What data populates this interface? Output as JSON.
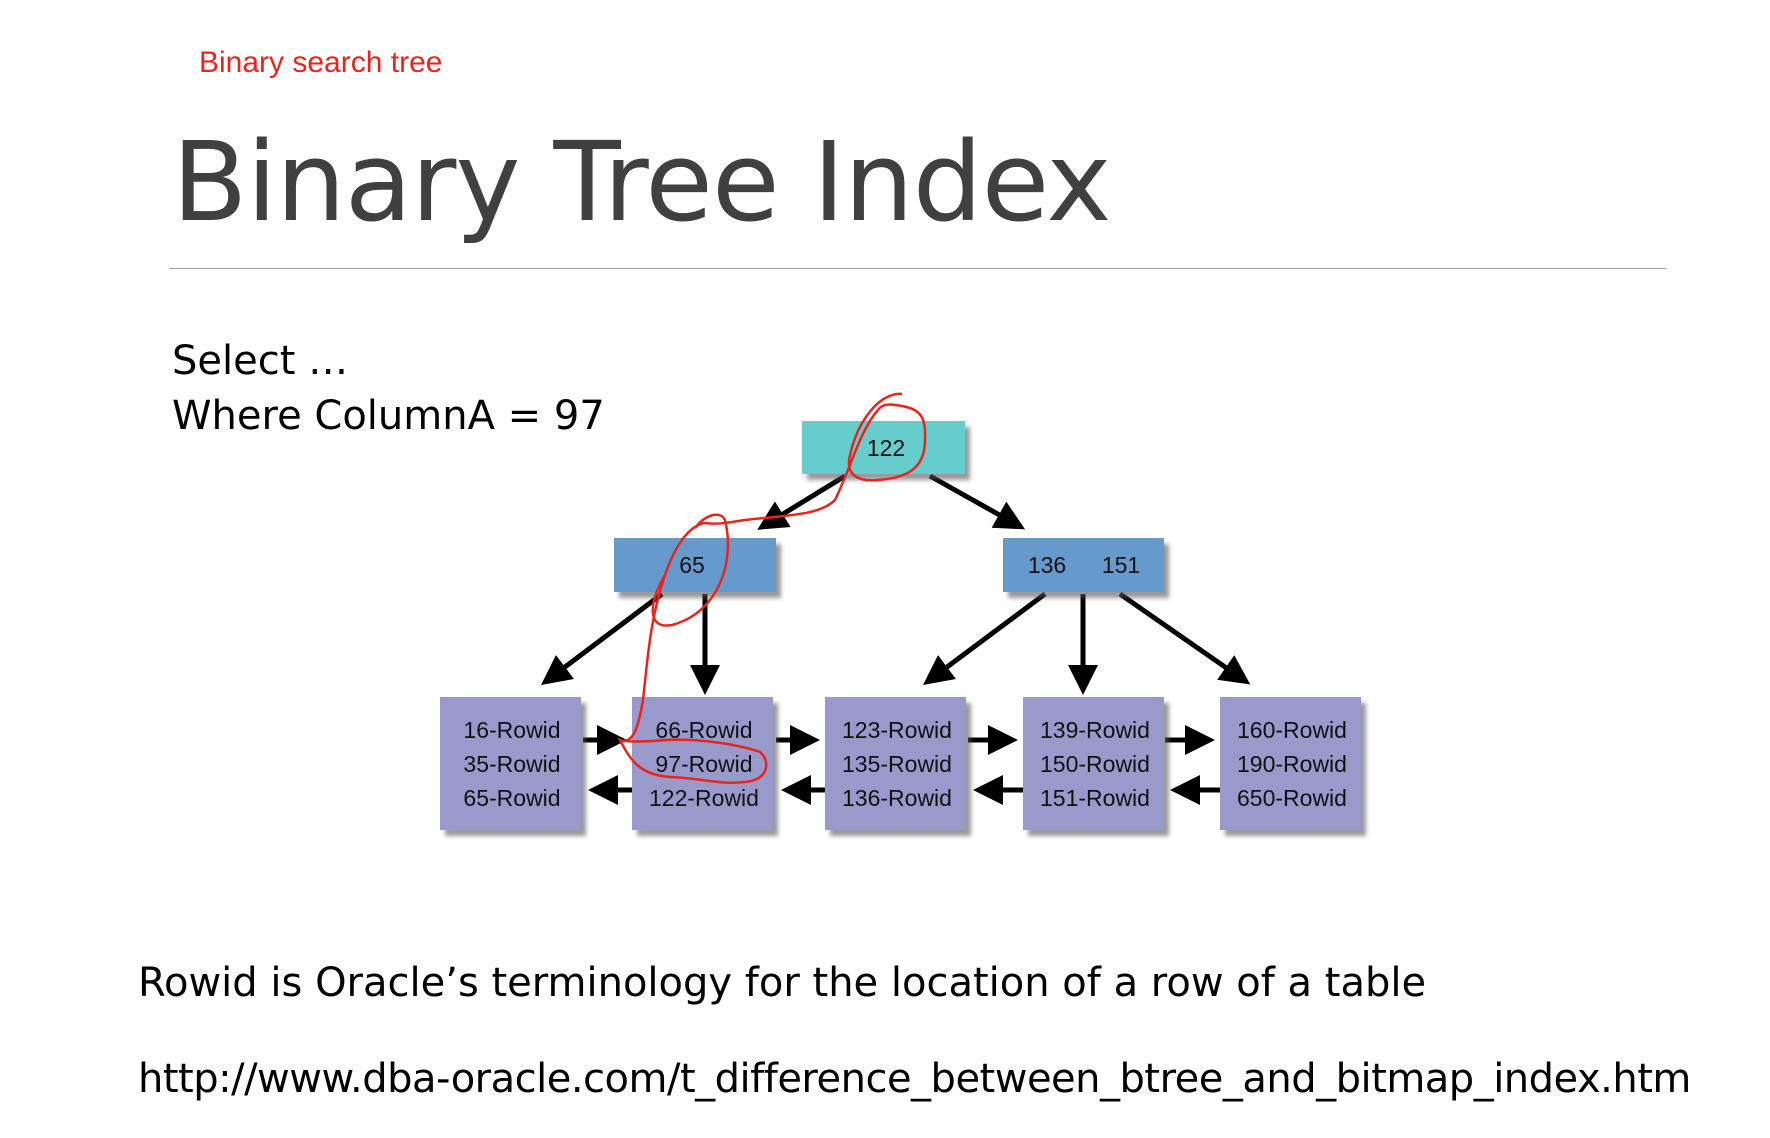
{
  "slide": {
    "subtitle": "Binary search tree",
    "title": "Binary Tree Index",
    "query": [
      "Select …",
      "Where ColumnA = 97"
    ],
    "note": "Rowid is Oracle’s terminology for the location of a row of a table",
    "url": "http://www.dba-oracle.com/t_difference_between_btree_and_bitmap_index.htm"
  },
  "tree": {
    "root": "122",
    "branches": [
      [
        "65"
      ],
      [
        "136",
        "151"
      ]
    ],
    "leaves": [
      [
        "16-Rowid",
        "35-Rowid",
        "65-Rowid"
      ],
      [
        "66-Rowid",
        "97-Rowid",
        "122-Rowid"
      ],
      [
        "123-Rowid",
        "135-Rowid",
        "136-Rowid"
      ],
      [
        "139-Rowid",
        "150-Rowid",
        "151-Rowid"
      ],
      [
        "160-Rowid",
        "190-Rowid",
        "650-Rowid"
      ]
    ],
    "colors": {
      "root": "#66cccc",
      "branch": "#6699cc",
      "leaf": "#9999cc",
      "annotation": "#e8251c"
    }
  }
}
